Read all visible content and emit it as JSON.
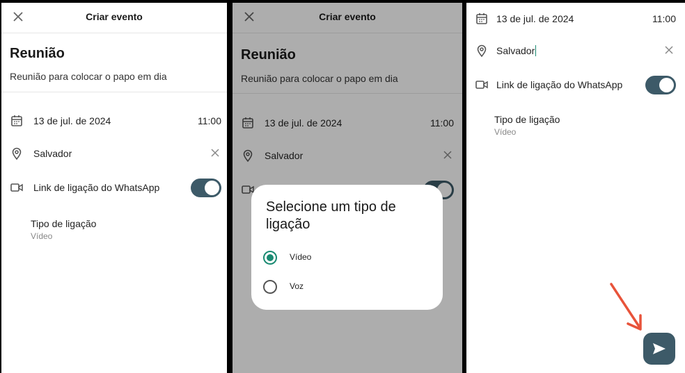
{
  "screens": [
    {
      "header": {
        "title": "Criar evento"
      },
      "event": {
        "name": "Reunião",
        "description": "Reunião para colocar o papo em dia"
      },
      "date": "13 de jul. de 2024",
      "time": "11:00",
      "location": "Salvador",
      "whatsapp_link": {
        "label": "Link de ligação do WhatsApp",
        "enabled": true
      },
      "call_type": {
        "label": "Tipo de ligação",
        "value": "Vídeo"
      }
    },
    {
      "header": {
        "title": "Criar evento"
      },
      "event": {
        "name": "Reunião",
        "description": "Reunião para colocar o papo em dia"
      },
      "date": "13 de jul. de 2024",
      "time": "11:00",
      "location": "Salvador",
      "dialog": {
        "title": "Selecione um tipo de ligação",
        "options": [
          {
            "label": "Vídeo",
            "selected": true
          },
          {
            "label": "Voz",
            "selected": false
          }
        ]
      }
    },
    {
      "date": "13 de jul. de 2024",
      "time": "11:00",
      "location": "Salvador",
      "whatsapp_link": {
        "label": "Link de ligação do WhatsApp",
        "enabled": true
      },
      "call_type": {
        "label": "Tipo de ligação",
        "value": "Vídeo"
      },
      "send_icon": "send-icon",
      "annotation_color": "#e8533a"
    }
  ],
  "colors": {
    "accent": "#3d5a68",
    "radio_selected": "#1a8a72"
  }
}
